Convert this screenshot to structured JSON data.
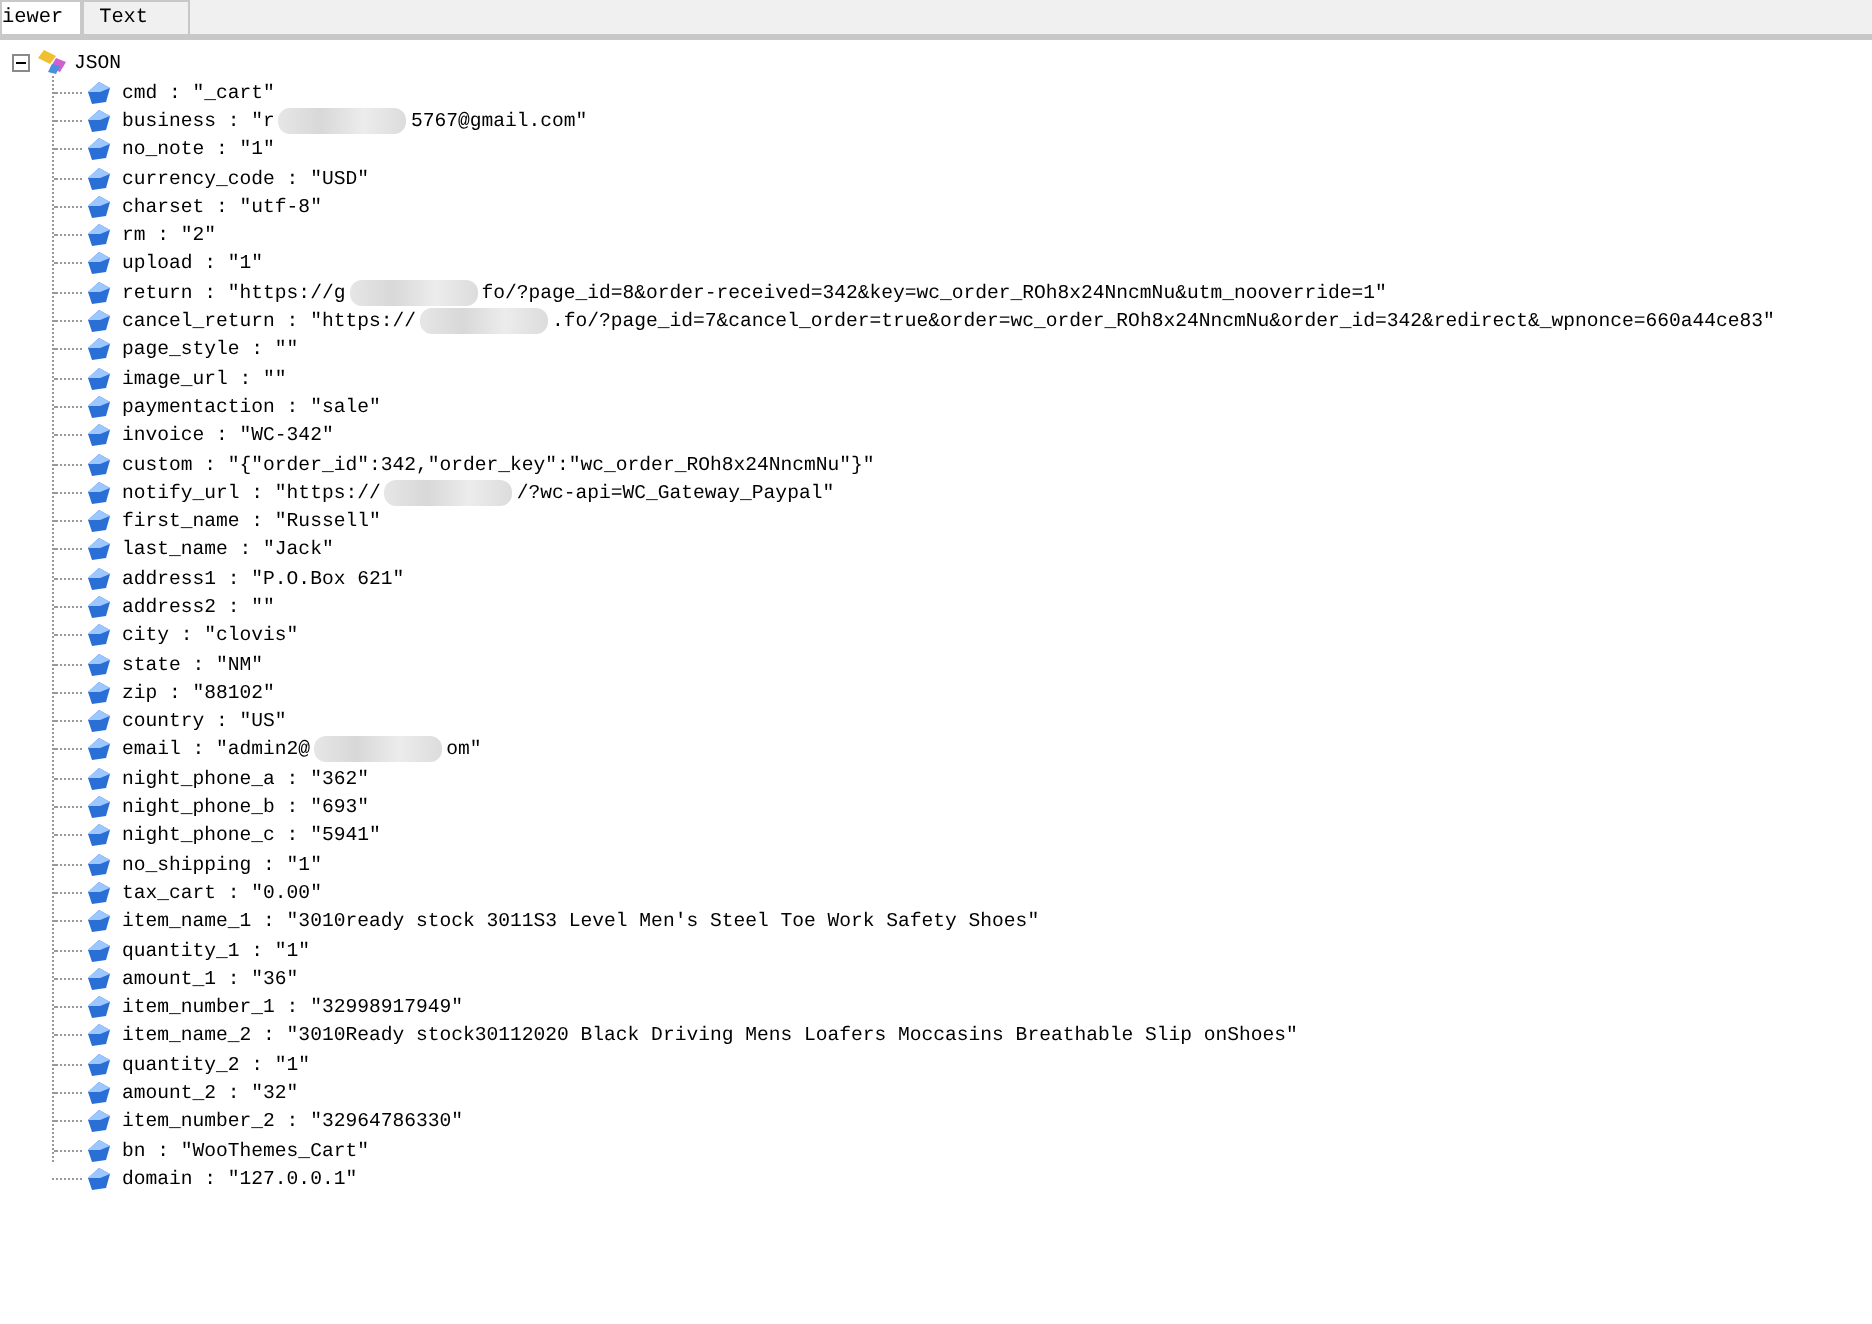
{
  "tabs": [
    {
      "label": "iewer",
      "selected": true
    },
    {
      "label": "Text",
      "selected": false
    }
  ],
  "tree": {
    "label": "JSON",
    "expanded": true,
    "children": [
      {
        "parts": [
          "cmd : \"_cart\""
        ]
      },
      {
        "parts": [
          "business : \"r",
          "5767@gmail.com\""
        ]
      },
      {
        "parts": [
          "no_note : \"1\""
        ]
      },
      {
        "parts": [
          "currency_code : \"USD\""
        ]
      },
      {
        "parts": [
          "charset : \"utf-8\""
        ]
      },
      {
        "parts": [
          "rm : \"2\""
        ]
      },
      {
        "parts": [
          "upload : \"1\""
        ]
      },
      {
        "parts": [
          "return : \"https://g",
          "fo/?page_id=8&order-received=342&key=wc_order_ROh8x24NncmNu&utm_nooverride=1\""
        ]
      },
      {
        "parts": [
          "cancel_return : \"https://",
          ".fo/?page_id=7&cancel_order=true&order=wc_order_ROh8x24NncmNu&order_id=342&redirect&_wpnonce=660a44ce83\""
        ]
      },
      {
        "parts": [
          "page_style : \"\""
        ]
      },
      {
        "parts": [
          "image_url : \"\""
        ]
      },
      {
        "parts": [
          "paymentaction : \"sale\""
        ]
      },
      {
        "parts": [
          "invoice : \"WC-342\""
        ]
      },
      {
        "parts": [
          "custom : \"{\"order_id\":342,\"order_key\":\"wc_order_ROh8x24NncmNu\"}\""
        ]
      },
      {
        "parts": [
          "notify_url : \"https://",
          "/?wc-api=WC_Gateway_Paypal\""
        ]
      },
      {
        "parts": [
          "first_name : \"Russell\""
        ]
      },
      {
        "parts": [
          "last_name : \"Jack\""
        ]
      },
      {
        "parts": [
          "address1 : \"P.O.Box 621\""
        ]
      },
      {
        "parts": [
          "address2 : \"\""
        ]
      },
      {
        "parts": [
          "city : \"clovis\""
        ]
      },
      {
        "parts": [
          "state : \"NM\""
        ]
      },
      {
        "parts": [
          "zip : \"88102\""
        ]
      },
      {
        "parts": [
          "country : \"US\""
        ]
      },
      {
        "parts": [
          "email : \"admin2@",
          "om\""
        ]
      },
      {
        "parts": [
          "night_phone_a : \"362\""
        ]
      },
      {
        "parts": [
          "night_phone_b : \"693\""
        ]
      },
      {
        "parts": [
          "night_phone_c : \"5941\""
        ]
      },
      {
        "parts": [
          "no_shipping : \"1\""
        ]
      },
      {
        "parts": [
          "tax_cart : \"0.00\""
        ]
      },
      {
        "parts": [
          "item_name_1 : \"3010ready stock 3011S3 Level Men's Steel Toe Work Safety Shoes\""
        ]
      },
      {
        "parts": [
          "quantity_1 : \"1\""
        ]
      },
      {
        "parts": [
          "amount_1 : \"36\""
        ]
      },
      {
        "parts": [
          "item_number_1 : \"32998917949\""
        ]
      },
      {
        "parts": [
          "item_name_2 : \"3010Ready stock30112020 Black Driving Mens Loafers Moccasins Breathable Slip onShoes\""
        ]
      },
      {
        "parts": [
          "quantity_2 : \"1\""
        ]
      },
      {
        "parts": [
          "amount_2 : \"32\""
        ]
      },
      {
        "parts": [
          "item_number_2 : \"32964786330\""
        ]
      },
      {
        "parts": [
          "bn : \"WooThemes_Cart\""
        ]
      },
      {
        "parts": [
          "domain : \"127.0.0.1\""
        ]
      }
    ]
  }
}
